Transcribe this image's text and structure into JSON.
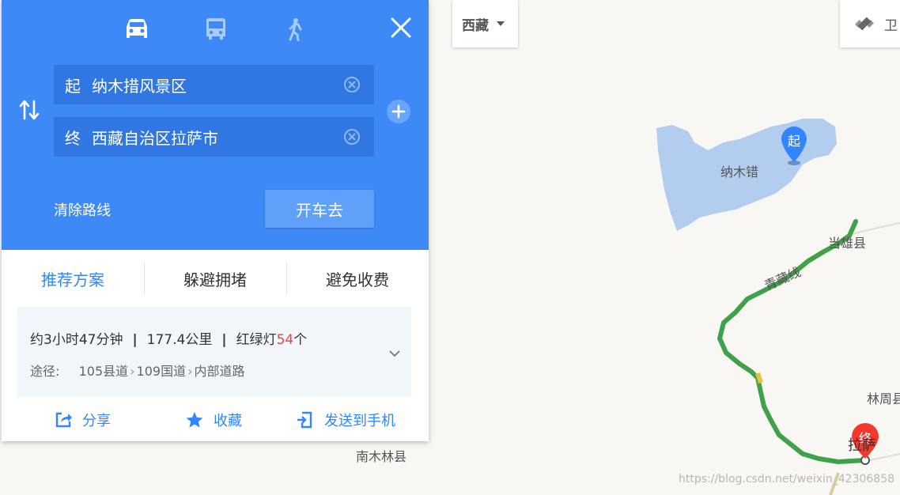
{
  "panel": {
    "modes": [
      {
        "name": "car",
        "icon": "car-icon",
        "active": true
      },
      {
        "name": "bus",
        "icon": "bus-icon",
        "active": false
      },
      {
        "name": "walk",
        "icon": "walk-icon",
        "active": false
      }
    ],
    "start": {
      "tag": "起",
      "value": "纳木措风景区"
    },
    "end": {
      "tag": "终",
      "value": "西藏自治区拉萨市"
    },
    "clear_route_label": "清除路线",
    "go_label": "开车去",
    "tabs": [
      "推荐方案",
      "躲避拥堵",
      "避免收费"
    ],
    "result": {
      "duration": "约3小时47分钟",
      "distance": "177.4公里",
      "lights_prefix": "红绿灯",
      "lights_count": "54",
      "lights_suffix": "个",
      "via_label": "途径:",
      "via": [
        "105县道",
        "109国道",
        "内部道路"
      ]
    },
    "actions": [
      {
        "label": "分享",
        "icon": "share-icon"
      },
      {
        "label": "收藏",
        "icon": "star-icon"
      },
      {
        "label": "发送到手机",
        "icon": "send-to-phone-icon"
      }
    ]
  },
  "top_controls": {
    "region_label": "西藏",
    "satellite_label": "卫"
  },
  "map": {
    "labels": {
      "lake": "纳木错",
      "dangxiong": "当雄县",
      "road": "青藏线",
      "linzhou": "林周县",
      "nanmulin": "南木林县",
      "lhasa": "拉萨"
    },
    "start_marker": "起",
    "end_marker": "终",
    "colors": {
      "route": "#3fa14a",
      "lake": "#b3cdef",
      "panel": "#3d8af7",
      "start_marker": "#3385ff",
      "end_marker": "#f4382d"
    }
  },
  "watermark": "https://blog.csdn.net/weixin_42306858"
}
